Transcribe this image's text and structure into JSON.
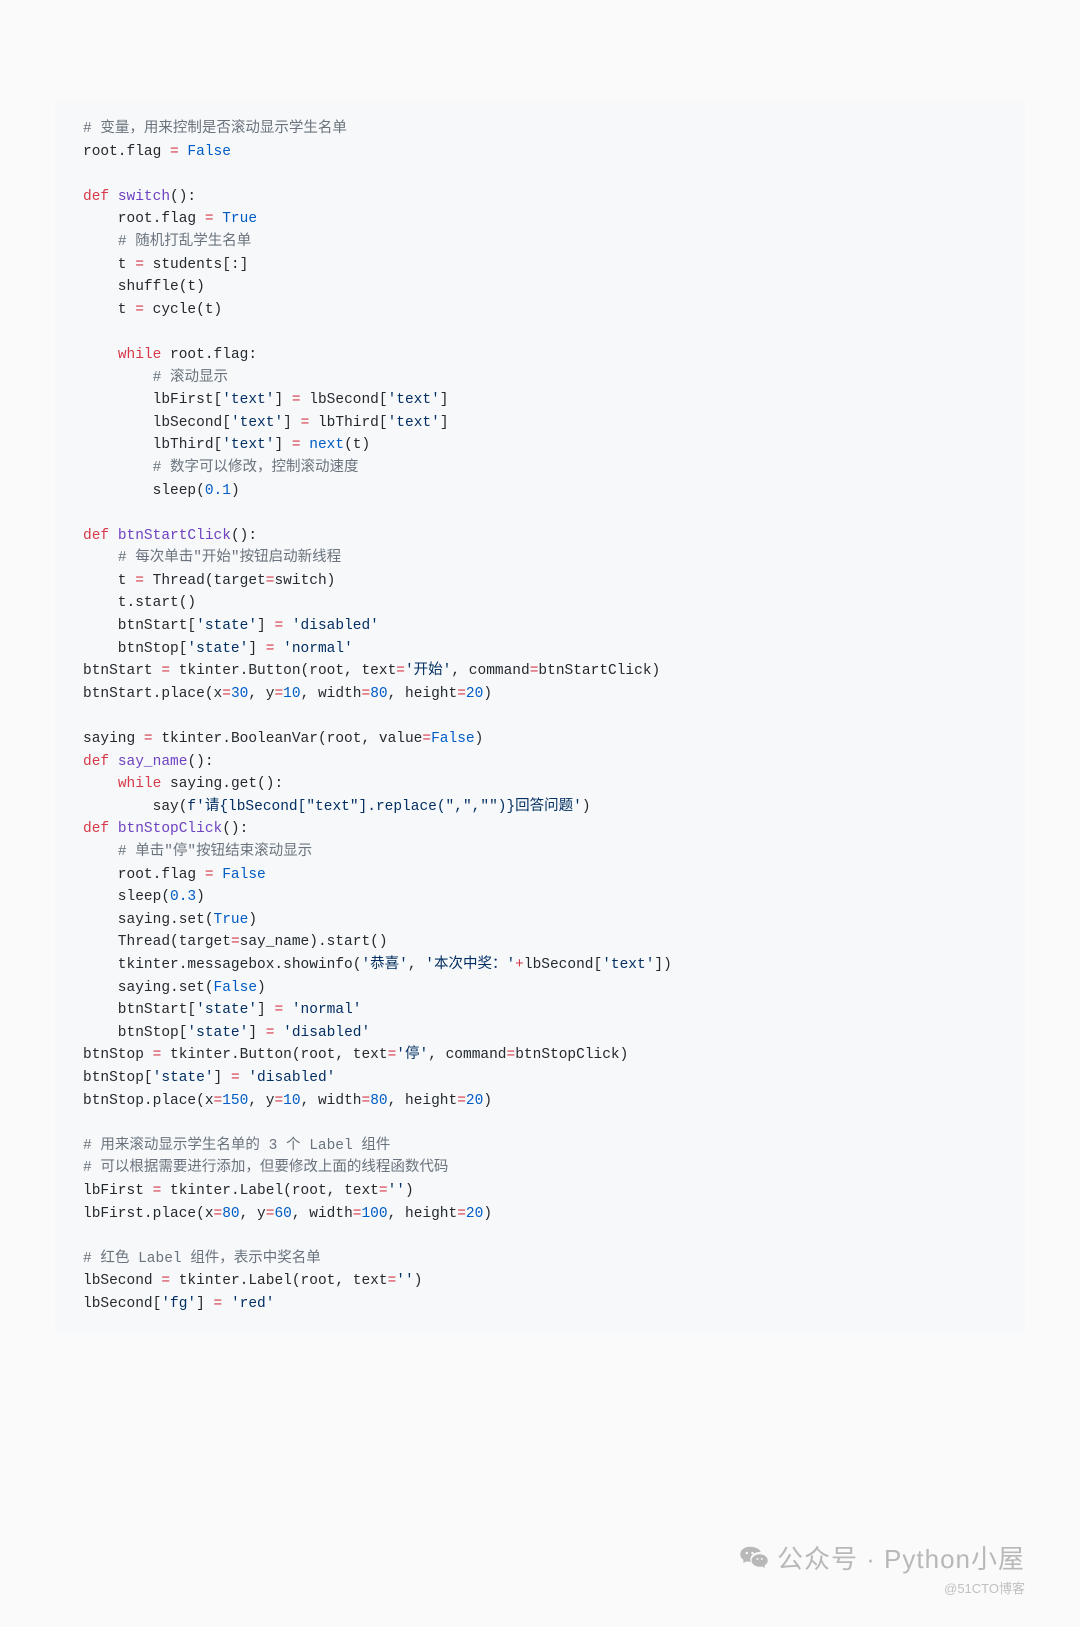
{
  "code": {
    "lines": [
      [
        {
          "c": "comment",
          "t": "# 变量，用来控制是否滚动显示学生名单"
        }
      ],
      [
        {
          "c": "plain",
          "t": "root.flag "
        },
        {
          "c": "keyword",
          "t": "="
        },
        {
          "c": "plain",
          "t": " "
        },
        {
          "c": "constant",
          "t": "False"
        }
      ],
      [
        {
          "c": "plain",
          "t": ""
        }
      ],
      [
        {
          "c": "keyword",
          "t": "def"
        },
        {
          "c": "plain",
          "t": " "
        },
        {
          "c": "function",
          "t": "switch"
        },
        {
          "c": "plain",
          "t": "():"
        }
      ],
      [
        {
          "c": "plain",
          "t": "    root.flag "
        },
        {
          "c": "keyword",
          "t": "="
        },
        {
          "c": "plain",
          "t": " "
        },
        {
          "c": "constant",
          "t": "True"
        }
      ],
      [
        {
          "c": "plain",
          "t": "    "
        },
        {
          "c": "comment",
          "t": "# 随机打乱学生名单"
        }
      ],
      [
        {
          "c": "plain",
          "t": "    t "
        },
        {
          "c": "keyword",
          "t": "="
        },
        {
          "c": "plain",
          "t": " students[:]"
        }
      ],
      [
        {
          "c": "plain",
          "t": "    shuffle(t)"
        }
      ],
      [
        {
          "c": "plain",
          "t": "    t "
        },
        {
          "c": "keyword",
          "t": "="
        },
        {
          "c": "plain",
          "t": " cycle(t)"
        }
      ],
      [
        {
          "c": "plain",
          "t": ""
        }
      ],
      [
        {
          "c": "plain",
          "t": "    "
        },
        {
          "c": "keyword",
          "t": "while"
        },
        {
          "c": "plain",
          "t": " root.flag:"
        }
      ],
      [
        {
          "c": "plain",
          "t": "        "
        },
        {
          "c": "comment",
          "t": "# 滚动显示"
        }
      ],
      [
        {
          "c": "plain",
          "t": "        lbFirst["
        },
        {
          "c": "string",
          "t": "'text'"
        },
        {
          "c": "plain",
          "t": "] "
        },
        {
          "c": "keyword",
          "t": "="
        },
        {
          "c": "plain",
          "t": " lbSecond["
        },
        {
          "c": "string",
          "t": "'text'"
        },
        {
          "c": "plain",
          "t": "]"
        }
      ],
      [
        {
          "c": "plain",
          "t": "        lbSecond["
        },
        {
          "c": "string",
          "t": "'text'"
        },
        {
          "c": "plain",
          "t": "] "
        },
        {
          "c": "keyword",
          "t": "="
        },
        {
          "c": "plain",
          "t": " lbThird["
        },
        {
          "c": "string",
          "t": "'text'"
        },
        {
          "c": "plain",
          "t": "]"
        }
      ],
      [
        {
          "c": "plain",
          "t": "        lbThird["
        },
        {
          "c": "string",
          "t": "'text'"
        },
        {
          "c": "plain",
          "t": "] "
        },
        {
          "c": "keyword",
          "t": "="
        },
        {
          "c": "plain",
          "t": " "
        },
        {
          "c": "keyword2",
          "t": "next"
        },
        {
          "c": "plain",
          "t": "(t)"
        }
      ],
      [
        {
          "c": "plain",
          "t": "        "
        },
        {
          "c": "comment",
          "t": "# 数字可以修改，控制滚动速度"
        }
      ],
      [
        {
          "c": "plain",
          "t": "        sleep("
        },
        {
          "c": "number",
          "t": "0.1"
        },
        {
          "c": "plain",
          "t": ")"
        }
      ],
      [
        {
          "c": "plain",
          "t": ""
        }
      ],
      [
        {
          "c": "keyword",
          "t": "def"
        },
        {
          "c": "plain",
          "t": " "
        },
        {
          "c": "function",
          "t": "btnStartClick"
        },
        {
          "c": "plain",
          "t": "():"
        }
      ],
      [
        {
          "c": "plain",
          "t": "    "
        },
        {
          "c": "comment",
          "t": "# 每次单击\"开始\"按钮启动新线程"
        }
      ],
      [
        {
          "c": "plain",
          "t": "    t "
        },
        {
          "c": "keyword",
          "t": "="
        },
        {
          "c": "plain",
          "t": " Thread("
        },
        {
          "c": "plain",
          "t": "target"
        },
        {
          "c": "keyword",
          "t": "="
        },
        {
          "c": "plain",
          "t": "switch)"
        }
      ],
      [
        {
          "c": "plain",
          "t": "    t.start()"
        }
      ],
      [
        {
          "c": "plain",
          "t": "    btnStart["
        },
        {
          "c": "string",
          "t": "'state'"
        },
        {
          "c": "plain",
          "t": "] "
        },
        {
          "c": "keyword",
          "t": "="
        },
        {
          "c": "plain",
          "t": " "
        },
        {
          "c": "string",
          "t": "'disabled'"
        }
      ],
      [
        {
          "c": "plain",
          "t": "    btnStop["
        },
        {
          "c": "string",
          "t": "'state'"
        },
        {
          "c": "plain",
          "t": "] "
        },
        {
          "c": "keyword",
          "t": "="
        },
        {
          "c": "plain",
          "t": " "
        },
        {
          "c": "string",
          "t": "'normal'"
        }
      ],
      [
        {
          "c": "plain",
          "t": "btnStart "
        },
        {
          "c": "keyword",
          "t": "="
        },
        {
          "c": "plain",
          "t": " tkinter.Button(root, "
        },
        {
          "c": "plain",
          "t": "text"
        },
        {
          "c": "keyword",
          "t": "="
        },
        {
          "c": "string",
          "t": "'开始'"
        },
        {
          "c": "plain",
          "t": ", "
        },
        {
          "c": "plain",
          "t": "command"
        },
        {
          "c": "keyword",
          "t": "="
        },
        {
          "c": "plain",
          "t": "btnStartClick)"
        }
      ],
      [
        {
          "c": "plain",
          "t": "btnStart.place("
        },
        {
          "c": "plain",
          "t": "x"
        },
        {
          "c": "keyword",
          "t": "="
        },
        {
          "c": "number",
          "t": "30"
        },
        {
          "c": "plain",
          "t": ", "
        },
        {
          "c": "plain",
          "t": "y"
        },
        {
          "c": "keyword",
          "t": "="
        },
        {
          "c": "number",
          "t": "10"
        },
        {
          "c": "plain",
          "t": ", "
        },
        {
          "c": "plain",
          "t": "width"
        },
        {
          "c": "keyword",
          "t": "="
        },
        {
          "c": "number",
          "t": "80"
        },
        {
          "c": "plain",
          "t": ", "
        },
        {
          "c": "plain",
          "t": "height"
        },
        {
          "c": "keyword",
          "t": "="
        },
        {
          "c": "number",
          "t": "20"
        },
        {
          "c": "plain",
          "t": ")"
        }
      ],
      [
        {
          "c": "plain",
          "t": ""
        }
      ],
      [
        {
          "c": "plain",
          "t": "saying "
        },
        {
          "c": "keyword",
          "t": "="
        },
        {
          "c": "plain",
          "t": " tkinter.BooleanVar(root, "
        },
        {
          "c": "plain",
          "t": "value"
        },
        {
          "c": "keyword",
          "t": "="
        },
        {
          "c": "constant",
          "t": "False"
        },
        {
          "c": "plain",
          "t": ")"
        }
      ],
      [
        {
          "c": "keyword",
          "t": "def"
        },
        {
          "c": "plain",
          "t": " "
        },
        {
          "c": "function",
          "t": "say_name"
        },
        {
          "c": "plain",
          "t": "():"
        }
      ],
      [
        {
          "c": "plain",
          "t": "    "
        },
        {
          "c": "keyword",
          "t": "while"
        },
        {
          "c": "plain",
          "t": " saying.get():"
        }
      ],
      [
        {
          "c": "plain",
          "t": "        say("
        },
        {
          "c": "string",
          "t": "f'请{lbSecond[\"text\"].replace(\",\",\"\")}回答问题'"
        },
        {
          "c": "plain",
          "t": ")"
        }
      ],
      [
        {
          "c": "keyword",
          "t": "def"
        },
        {
          "c": "plain",
          "t": " "
        },
        {
          "c": "function",
          "t": "btnStopClick"
        },
        {
          "c": "plain",
          "t": "():"
        }
      ],
      [
        {
          "c": "plain",
          "t": "    "
        },
        {
          "c": "comment",
          "t": "# 单击\"停\"按钮结束滚动显示"
        }
      ],
      [
        {
          "c": "plain",
          "t": "    root.flag "
        },
        {
          "c": "keyword",
          "t": "="
        },
        {
          "c": "plain",
          "t": " "
        },
        {
          "c": "constant",
          "t": "False"
        }
      ],
      [
        {
          "c": "plain",
          "t": "    sleep("
        },
        {
          "c": "number",
          "t": "0.3"
        },
        {
          "c": "plain",
          "t": ")"
        }
      ],
      [
        {
          "c": "plain",
          "t": "    saying.set("
        },
        {
          "c": "constant",
          "t": "True"
        },
        {
          "c": "plain",
          "t": ")"
        }
      ],
      [
        {
          "c": "plain",
          "t": "    Thread("
        },
        {
          "c": "plain",
          "t": "target"
        },
        {
          "c": "keyword",
          "t": "="
        },
        {
          "c": "plain",
          "t": "say_name).start()"
        }
      ],
      [
        {
          "c": "plain",
          "t": "    tkinter.messagebox.showinfo("
        },
        {
          "c": "string",
          "t": "'恭喜'"
        },
        {
          "c": "plain",
          "t": ", "
        },
        {
          "c": "string",
          "t": "'本次中奖：'"
        },
        {
          "c": "keyword",
          "t": "+"
        },
        {
          "c": "plain",
          "t": "lbSecond["
        },
        {
          "c": "string",
          "t": "'text'"
        },
        {
          "c": "plain",
          "t": "])"
        }
      ],
      [
        {
          "c": "plain",
          "t": "    saying.set("
        },
        {
          "c": "constant",
          "t": "False"
        },
        {
          "c": "plain",
          "t": ")"
        }
      ],
      [
        {
          "c": "plain",
          "t": "    btnStart["
        },
        {
          "c": "string",
          "t": "'state'"
        },
        {
          "c": "plain",
          "t": "] "
        },
        {
          "c": "keyword",
          "t": "="
        },
        {
          "c": "plain",
          "t": " "
        },
        {
          "c": "string",
          "t": "'normal'"
        }
      ],
      [
        {
          "c": "plain",
          "t": "    btnStop["
        },
        {
          "c": "string",
          "t": "'state'"
        },
        {
          "c": "plain",
          "t": "] "
        },
        {
          "c": "keyword",
          "t": "="
        },
        {
          "c": "plain",
          "t": " "
        },
        {
          "c": "string",
          "t": "'disabled'"
        }
      ],
      [
        {
          "c": "plain",
          "t": "btnStop "
        },
        {
          "c": "keyword",
          "t": "="
        },
        {
          "c": "plain",
          "t": " tkinter.Button(root, "
        },
        {
          "c": "plain",
          "t": "text"
        },
        {
          "c": "keyword",
          "t": "="
        },
        {
          "c": "string",
          "t": "'停'"
        },
        {
          "c": "plain",
          "t": ", "
        },
        {
          "c": "plain",
          "t": "command"
        },
        {
          "c": "keyword",
          "t": "="
        },
        {
          "c": "plain",
          "t": "btnStopClick)"
        }
      ],
      [
        {
          "c": "plain",
          "t": "btnStop["
        },
        {
          "c": "string",
          "t": "'state'"
        },
        {
          "c": "plain",
          "t": "] "
        },
        {
          "c": "keyword",
          "t": "="
        },
        {
          "c": "plain",
          "t": " "
        },
        {
          "c": "string",
          "t": "'disabled'"
        }
      ],
      [
        {
          "c": "plain",
          "t": "btnStop.place("
        },
        {
          "c": "plain",
          "t": "x"
        },
        {
          "c": "keyword",
          "t": "="
        },
        {
          "c": "number",
          "t": "150"
        },
        {
          "c": "plain",
          "t": ", "
        },
        {
          "c": "plain",
          "t": "y"
        },
        {
          "c": "keyword",
          "t": "="
        },
        {
          "c": "number",
          "t": "10"
        },
        {
          "c": "plain",
          "t": ", "
        },
        {
          "c": "plain",
          "t": "width"
        },
        {
          "c": "keyword",
          "t": "="
        },
        {
          "c": "number",
          "t": "80"
        },
        {
          "c": "plain",
          "t": ", "
        },
        {
          "c": "plain",
          "t": "height"
        },
        {
          "c": "keyword",
          "t": "="
        },
        {
          "c": "number",
          "t": "20"
        },
        {
          "c": "plain",
          "t": ")"
        }
      ],
      [
        {
          "c": "plain",
          "t": ""
        }
      ],
      [
        {
          "c": "comment",
          "t": "# 用来滚动显示学生名单的 3 个 Label 组件"
        }
      ],
      [
        {
          "c": "comment",
          "t": "# 可以根据需要进行添加，但要修改上面的线程函数代码"
        }
      ],
      [
        {
          "c": "plain",
          "t": "lbFirst "
        },
        {
          "c": "keyword",
          "t": "="
        },
        {
          "c": "plain",
          "t": " tkinter.Label(root, "
        },
        {
          "c": "plain",
          "t": "text"
        },
        {
          "c": "keyword",
          "t": "="
        },
        {
          "c": "string",
          "t": "''"
        },
        {
          "c": "plain",
          "t": ")"
        }
      ],
      [
        {
          "c": "plain",
          "t": "lbFirst.place("
        },
        {
          "c": "plain",
          "t": "x"
        },
        {
          "c": "keyword",
          "t": "="
        },
        {
          "c": "number",
          "t": "80"
        },
        {
          "c": "plain",
          "t": ", "
        },
        {
          "c": "plain",
          "t": "y"
        },
        {
          "c": "keyword",
          "t": "="
        },
        {
          "c": "number",
          "t": "60"
        },
        {
          "c": "plain",
          "t": ", "
        },
        {
          "c": "plain",
          "t": "width"
        },
        {
          "c": "keyword",
          "t": "="
        },
        {
          "c": "number",
          "t": "100"
        },
        {
          "c": "plain",
          "t": ", "
        },
        {
          "c": "plain",
          "t": "height"
        },
        {
          "c": "keyword",
          "t": "="
        },
        {
          "c": "number",
          "t": "20"
        },
        {
          "c": "plain",
          "t": ")"
        }
      ],
      [
        {
          "c": "plain",
          "t": ""
        }
      ],
      [
        {
          "c": "comment",
          "t": "# 红色 Label 组件，表示中奖名单"
        }
      ],
      [
        {
          "c": "plain",
          "t": "lbSecond "
        },
        {
          "c": "keyword",
          "t": "="
        },
        {
          "c": "plain",
          "t": " tkinter.Label(root, "
        },
        {
          "c": "plain",
          "t": "text"
        },
        {
          "c": "keyword",
          "t": "="
        },
        {
          "c": "string",
          "t": "''"
        },
        {
          "c": "plain",
          "t": ")"
        }
      ],
      [
        {
          "c": "plain",
          "t": "lbSecond["
        },
        {
          "c": "string",
          "t": "'fg'"
        },
        {
          "c": "plain",
          "t": "] "
        },
        {
          "c": "keyword",
          "t": "="
        },
        {
          "c": "plain",
          "t": " "
        },
        {
          "c": "string",
          "t": "'red'"
        }
      ]
    ]
  },
  "watermark": {
    "line1": "公众号 · Python小屋",
    "line2": "@51CTO博客"
  }
}
